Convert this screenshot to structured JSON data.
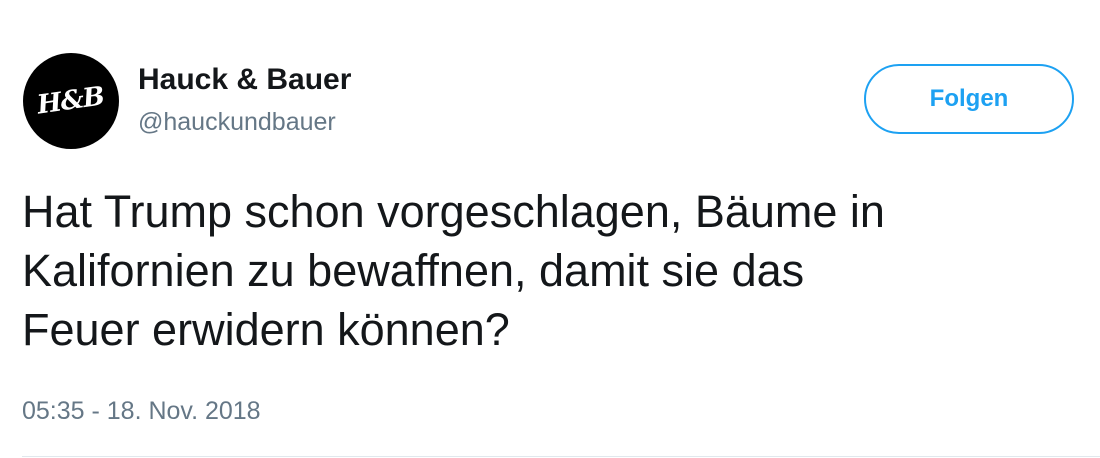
{
  "user": {
    "avatar_text": "H&B",
    "display_name": "Hauck & Bauer",
    "handle": "@hauckundbauer"
  },
  "follow_button": {
    "label": "Folgen"
  },
  "tweet": {
    "lines": [
      "Hat Trump schon vorgeschlagen, Bäume in",
      "Kalifornien zu bewaffnen, damit sie das",
      "Feuer erwidern können?"
    ],
    "timestamp": "05:35 - 18. Nov. 2018"
  },
  "colors": {
    "accent": "#1da1f2",
    "text_primary": "#14171a",
    "text_secondary": "#657786",
    "divider": "#e1e8ed",
    "avatar_bg": "#000000"
  }
}
